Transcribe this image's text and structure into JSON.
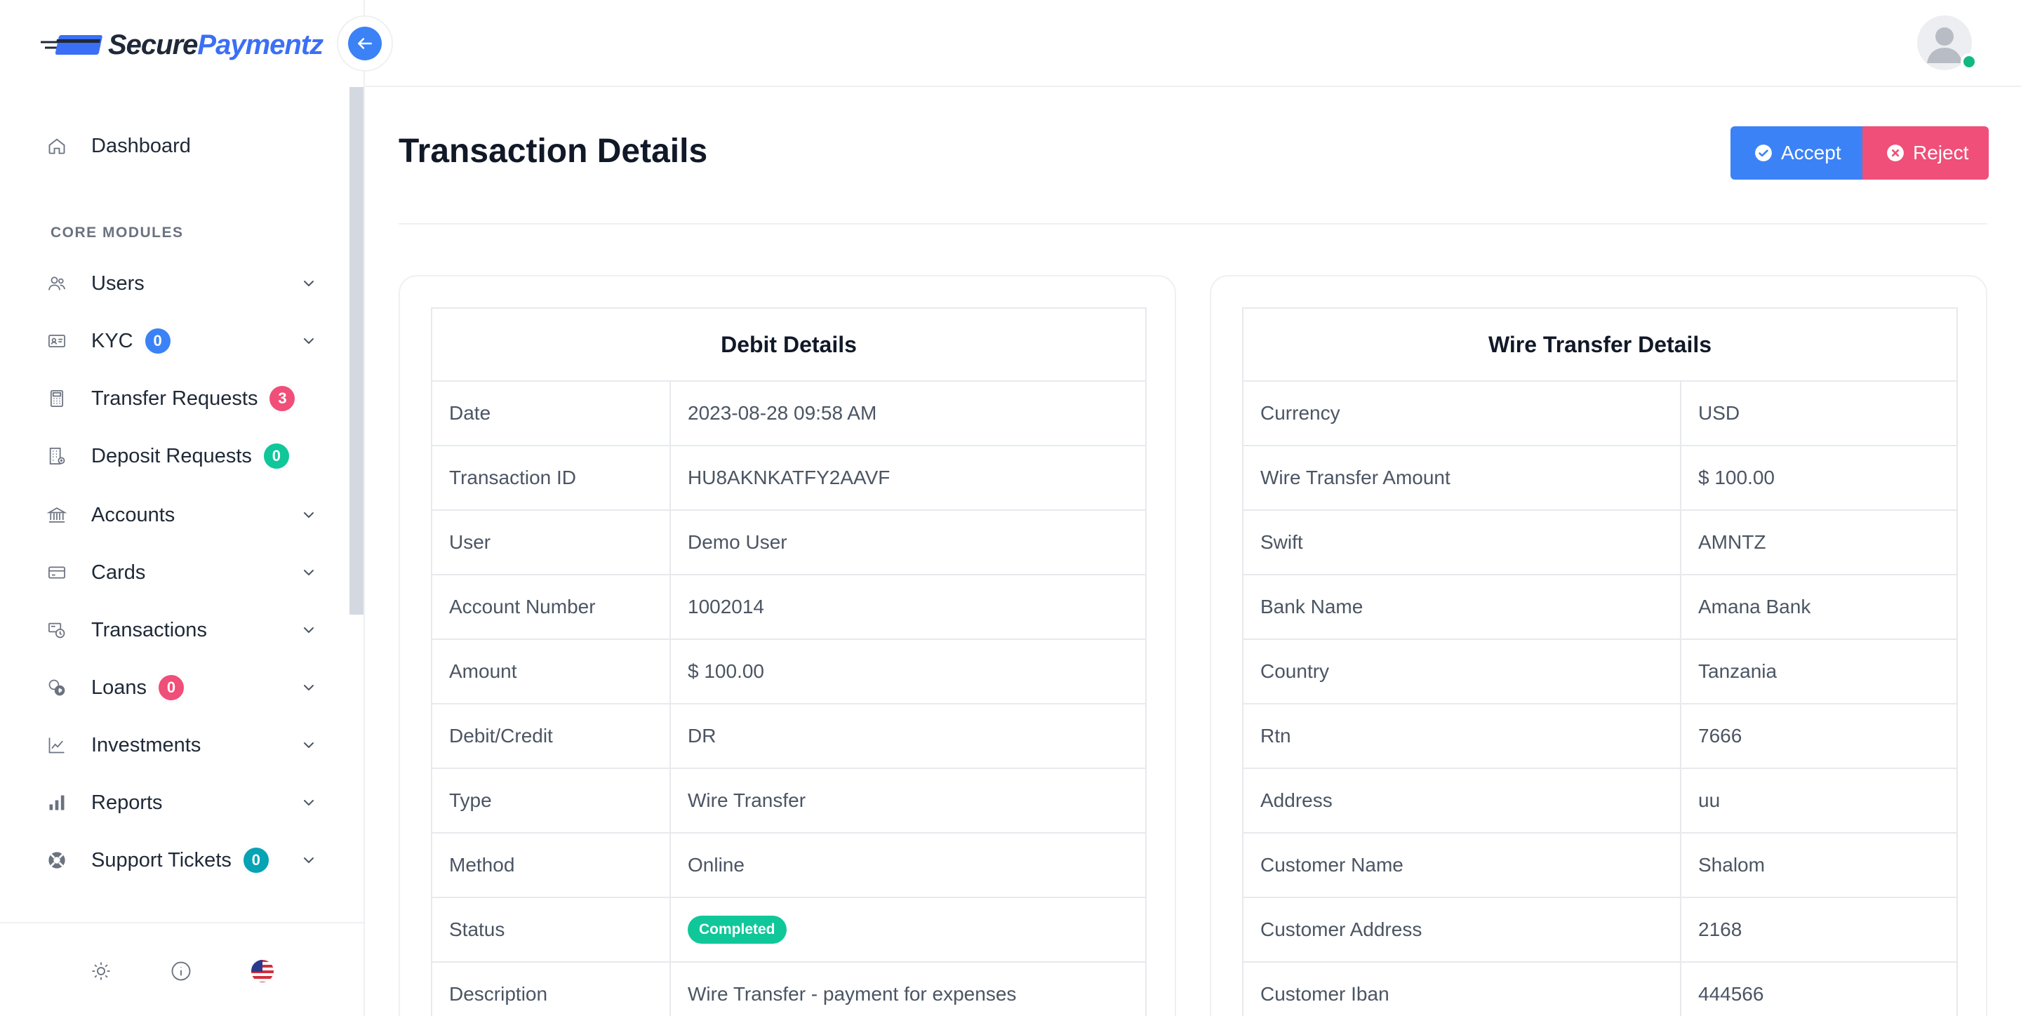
{
  "brand": {
    "name_part1": "Secure",
    "name_part2": "Paymentz"
  },
  "colors": {
    "primary": "#3b82f6",
    "danger": "#ef4f78",
    "success": "#10c79a",
    "info": "#06a3b5"
  },
  "sidebar": {
    "dashboard": {
      "label": "Dashboard",
      "icon": "home-icon"
    },
    "section_label": "CORE MODULES",
    "items": [
      {
        "label": "Users",
        "icon": "users-icon",
        "badge": null,
        "chevron": true
      },
      {
        "label": "KYC",
        "icon": "id-card-icon",
        "badge": "0",
        "badge_color": "#3b82f6",
        "chevron": true
      },
      {
        "label": "Transfer Requests",
        "icon": "calculator-icon",
        "badge": "3",
        "badge_color": "#ef4f78",
        "chevron": false
      },
      {
        "label": "Deposit Requests",
        "icon": "building-icon",
        "badge": "0",
        "badge_color": "#10c79a",
        "chevron": false
      },
      {
        "label": "Accounts",
        "icon": "bank-icon",
        "badge": null,
        "chevron": true
      },
      {
        "label": "Cards",
        "icon": "card-icon",
        "badge": null,
        "chevron": true
      },
      {
        "label": "Transactions",
        "icon": "transactions-icon",
        "badge": null,
        "chevron": true
      },
      {
        "label": "Loans",
        "icon": "coins-icon",
        "badge": "0",
        "badge_color": "#ef4f78",
        "chevron": true
      },
      {
        "label": "Investments",
        "icon": "trend-icon",
        "badge": null,
        "chevron": true
      },
      {
        "label": "Reports",
        "icon": "bar-chart-icon",
        "badge": null,
        "chevron": true
      },
      {
        "label": "Support Tickets",
        "icon": "lifebuoy-icon",
        "badge": "0",
        "badge_color": "#06a3b5",
        "chevron": true
      }
    ],
    "footer": [
      "sun-icon",
      "info-icon",
      "us-flag-icon"
    ]
  },
  "page": {
    "title": "Transaction Details",
    "accept_label": "Accept",
    "reject_label": "Reject"
  },
  "debit": {
    "title": "Debit Details",
    "rows": [
      {
        "label": "Date",
        "value": "2023-08-28 09:58 AM"
      },
      {
        "label": "Transaction ID",
        "value": "HU8AKNKATFY2AAVF"
      },
      {
        "label": "User",
        "value": "Demo User"
      },
      {
        "label": "Account Number",
        "value": "1002014"
      },
      {
        "label": "Amount",
        "value": "$ 100.00"
      },
      {
        "label": "Debit/Credit",
        "value": "DR"
      },
      {
        "label": "Type",
        "value": "Wire Transfer"
      },
      {
        "label": "Method",
        "value": "Online"
      },
      {
        "label": "Status",
        "value": "Completed"
      },
      {
        "label": "Description",
        "value": "Wire Transfer - payment for expenses"
      }
    ]
  },
  "wire": {
    "title": "Wire Transfer Details",
    "rows": [
      {
        "label": "Currency",
        "value": "USD"
      },
      {
        "label": "Wire Transfer Amount",
        "value": "$ 100.00"
      },
      {
        "label": "Swift",
        "value": "AMNTZ"
      },
      {
        "label": "Bank Name",
        "value": "Amana Bank"
      },
      {
        "label": "Country",
        "value": "Tanzania"
      },
      {
        "label": "Rtn",
        "value": "7666"
      },
      {
        "label": "Address",
        "value": "uu"
      },
      {
        "label": "Customer Name",
        "value": "Shalom"
      },
      {
        "label": "Customer Address",
        "value": "2168"
      },
      {
        "label": "Customer Iban",
        "value": "444566"
      }
    ]
  }
}
